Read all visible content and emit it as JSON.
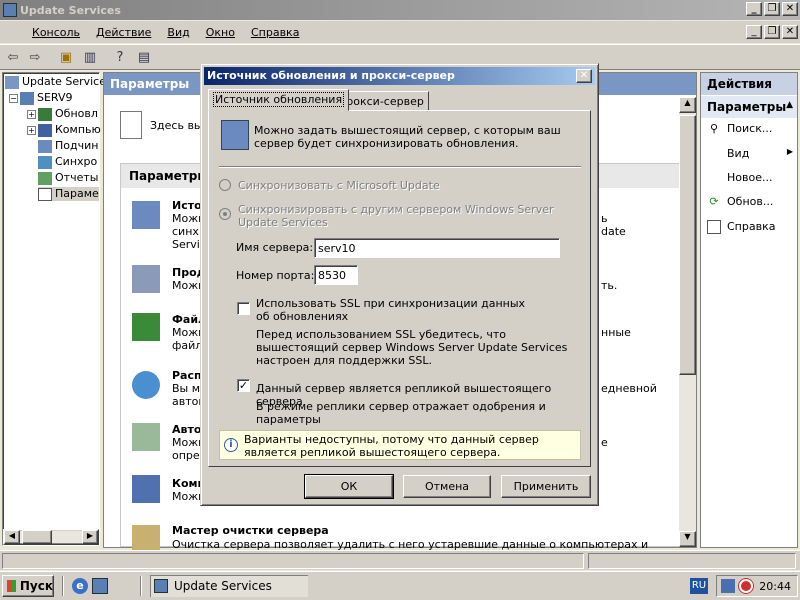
{
  "window": {
    "title": "Update Services"
  },
  "menu": {
    "items": [
      "Консоль",
      "Действие",
      "Вид",
      "Окно",
      "Справка"
    ]
  },
  "tree": {
    "items": [
      {
        "label": "Update Service",
        "level": 0
      },
      {
        "label": "SERV9",
        "level": 1
      },
      {
        "label": "Обновл",
        "level": 2
      },
      {
        "label": "Компью",
        "level": 2
      },
      {
        "label": "Подчин",
        "level": 2
      },
      {
        "label": "Синхро",
        "level": 2
      },
      {
        "label": "Отчеты",
        "level": 2
      },
      {
        "label": "Параме",
        "level": 2
      }
    ]
  },
  "center": {
    "header": "Параметры",
    "intro": "Здесь вы",
    "section_title": "Параметры",
    "items": [
      {
        "title": "Исто",
        "lines": [
          "Можн",
          "синх",
          "Servi"
        ],
        "tail": [
          "ь",
          "date"
        ]
      },
      {
        "title": "Прод",
        "lines": [
          "Можн"
        ],
        "tail": [
          "ть."
        ]
      },
      {
        "title": "Файл",
        "lines": [
          "Можн",
          "файл"
        ],
        "tail": [
          "нные"
        ]
      },
      {
        "title": "Расп",
        "lines": [
          "Вы м",
          "автом"
        ],
        "tail": [
          "едневной"
        ]
      },
      {
        "title": "Авто",
        "lines": [
          "Можн",
          "опред"
        ],
        "tail": [
          "е"
        ]
      },
      {
        "title": "Комп",
        "lines": [
          "Можн"
        ],
        "tail": []
      }
    ],
    "cleanup": {
      "title": "Мастер очистки сервера",
      "desc": "Очистка сервера позволяет удалить с него устаревшие данные о компьютерах и"
    }
  },
  "actions": {
    "header": "Действия",
    "section": "Параметры",
    "items": [
      "Поиск...",
      "Вид",
      "Новое...",
      "Обнов...",
      "Справка"
    ]
  },
  "taskbar": {
    "start": "Пуск",
    "task": "Update Services",
    "lang": "RU",
    "time": "20:44"
  },
  "dialog": {
    "title": "Источник обновления и прокси-сервер",
    "tabs": [
      "Источник обновления",
      "Прокси-сервер"
    ],
    "intro": "Можно задать вышестоящий сервер, с которым ваш сервер будет синхронизировать обновления.",
    "radio_ms": "Синхронизовать с Microsoft Update",
    "radio_other": "Синхронизировать с другим сервером Windows Server Update Services",
    "server_label": "Имя сервера:",
    "server_value": "serv10",
    "port_label": "Номер порта:",
    "port_value": "8530",
    "ssl_label": "Использовать SSL при синхронизации данных об обновлениях",
    "ssl_note": "Перед использованием SSL убедитесь, что вышестоящий сервер Windows Server Update Services настроен для поддержки SSL.",
    "replica_label": "Данный сервер является репликой вышестоящего сервера",
    "replica_note": "В режиме реплики сервер отражает одобрения и параметры",
    "info": "Варианты недоступны, потому что данный сервер является репликой вышестоящего сервера.",
    "ok": "ОК",
    "cancel": "Отмена",
    "apply": "Применить"
  }
}
